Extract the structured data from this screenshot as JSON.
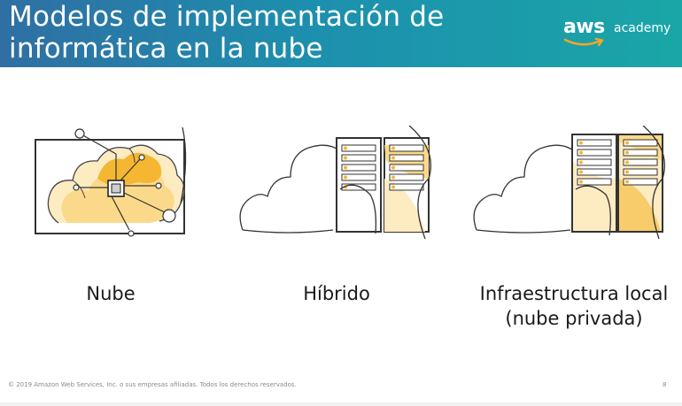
{
  "header": {
    "title_line1": "Modelos de implementación de",
    "title_line2": "informática en la nube",
    "logo_mark": "aws",
    "logo_text": "academy",
    "background": "#1d8fae"
  },
  "models": [
    {
      "label_line1": "Nube",
      "label_line2": "",
      "icon": "cloud-chip-icon"
    },
    {
      "label_line1": "Híbrido",
      "label_line2": "",
      "icon": "hybrid-cloud-server-icon"
    },
    {
      "label_line1": "Infraestructura local",
      "label_line2": "(nube privada)",
      "icon": "on-premises-server-icon"
    }
  ],
  "colors": {
    "accent_orange": "#f5b731",
    "light_orange": "#fbd98a",
    "pale_orange": "#fdebc2",
    "line": "#333333"
  },
  "footer": {
    "copyright": "© 2019 Amazon Web Services, Inc. o sus empresas afiliadas. Todos los derechos reservados.",
    "page_number": "8"
  }
}
